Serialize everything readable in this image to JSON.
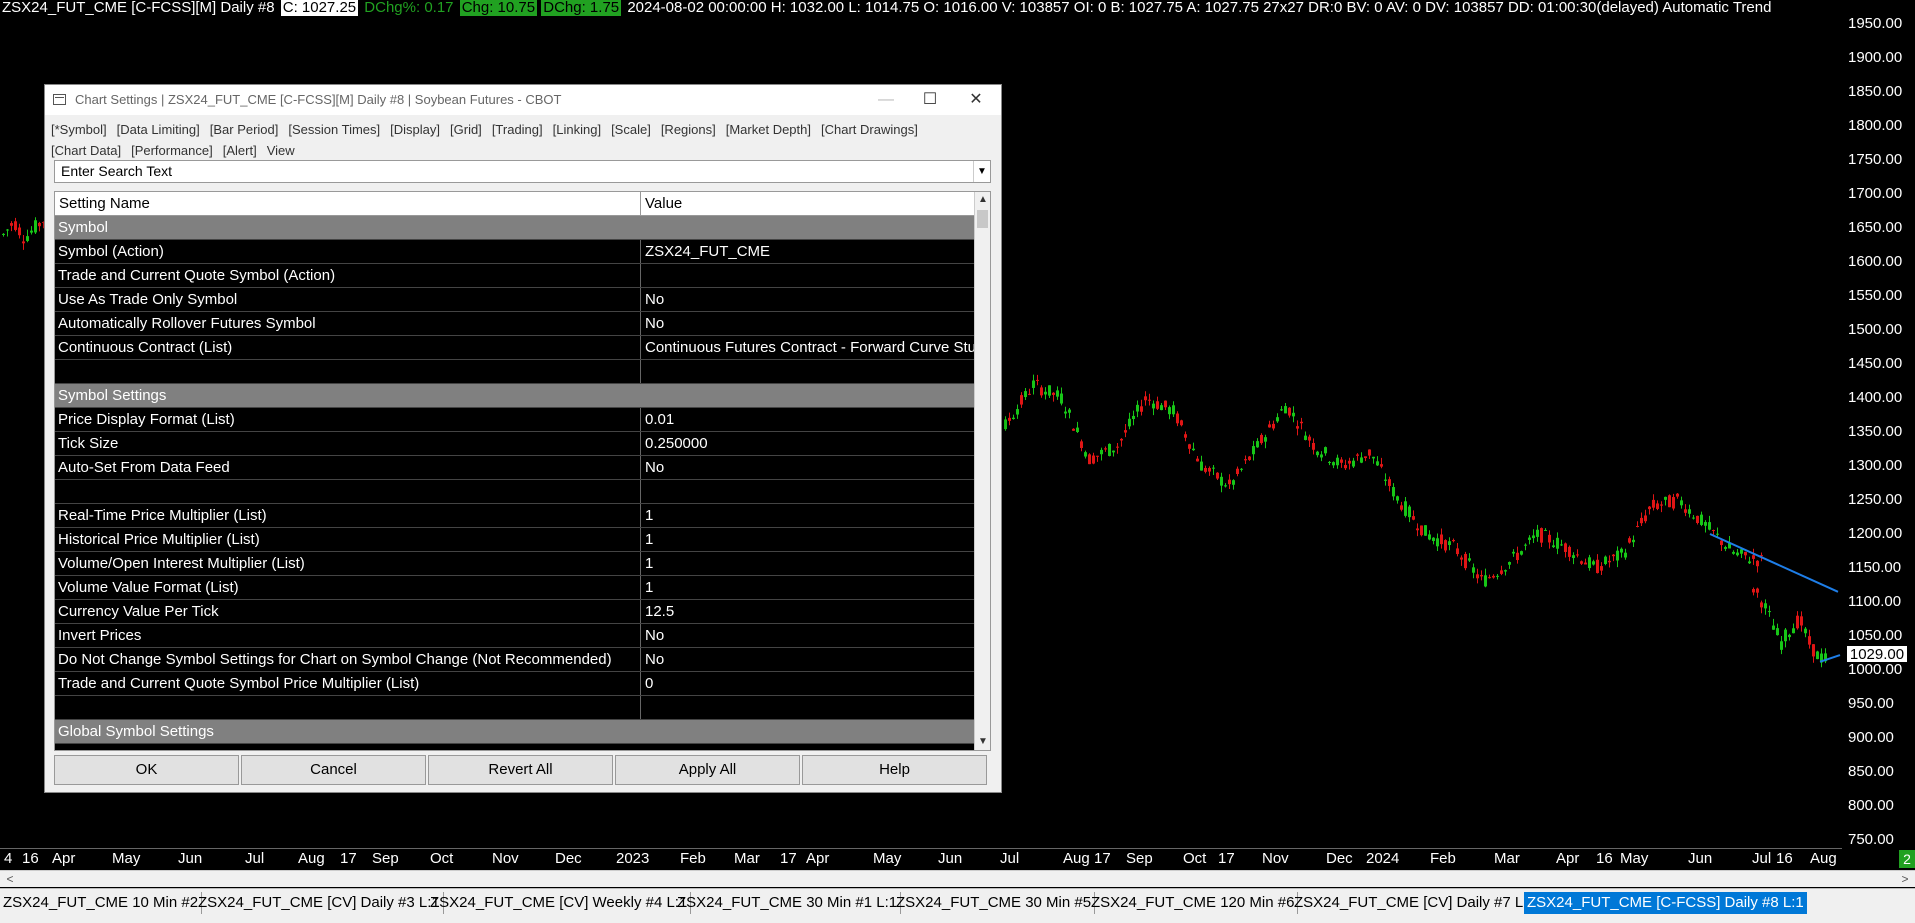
{
  "topbar": {
    "symbol": "ZSX24_FUT_CME [C-FCSS][M]  Daily #8",
    "close": "C: 1027.25",
    "dchg_pct": "DChg%: 0.17",
    "chg": "Chg: 10.75",
    "dchg": "DChg: 1.75",
    "rest": "2024-08-02 00:00:00 H: 1032.00 L: 1014.75 O: 1016.00 V: 103857 OI: 0 B: 1027.75 A: 1027.75 27x27 DR:0 BV: 0 AV: 0 DV: 103857 DD: 01:00:30(delayed) Automatic Trend"
  },
  "yaxis": {
    "ticks": [
      "1950.00",
      "1900.00",
      "1850.00",
      "1800.00",
      "1750.00",
      "1700.00",
      "1650.00",
      "1600.00",
      "1550.00",
      "1500.00",
      "1450.00",
      "1400.00",
      "1350.00",
      "1300.00",
      "1250.00",
      "1200.00",
      "1150.00",
      "1100.00",
      "1050.00",
      "1000.00",
      "950.00",
      "900.00",
      "850.00",
      "800.00",
      "750.00"
    ],
    "current_price": "1029.00"
  },
  "xaxis": {
    "ticks": [
      "4",
      "16",
      "Apr",
      "May",
      "Jun",
      "Jul",
      "Aug",
      "17",
      "Sep",
      "Oct",
      "Nov",
      "Dec",
      "2023",
      "Feb",
      "Mar",
      "17",
      "Apr",
      "May",
      "Jun",
      "Jul",
      "Aug",
      "17",
      "Sep",
      "Oct",
      "17",
      "Nov",
      "Dec",
      "2024",
      "Feb",
      "Mar",
      "Apr",
      "16",
      "May",
      "Jun",
      "Jul",
      "16",
      "Aug"
    ]
  },
  "colors": {
    "up": "#17c617",
    "down": "#e01515",
    "trendline": "#1e7ee8",
    "tab_active": "#0078d7",
    "badge": "#21a121"
  },
  "series": {
    "trend_closes": [
      1205,
      1195,
      1185,
      1182,
      1175,
      1168,
      1160,
      1150,
      1142,
      1135,
      1140,
      1120,
      1115,
      1110,
      1090,
      1075,
      1070,
      1062,
      1055,
      1050,
      1045,
      1040,
      1050,
      1060,
      1070,
      1065,
      1040,
      1030,
      1020,
      1015,
      1025,
      1029
    ]
  },
  "badge": "2",
  "tabs": [
    "ZSX24_FUT_CME  10 Min  #2",
    "ZSX24_FUT_CME [CV]  Daily #3 L:1",
    "ZSX24_FUT_CME [CV]  Weekly #4 L:1",
    "ZSX24_FUT_CME  30 Min  #1 L:1",
    "ZSX24_FUT_CME  30 Min  #5",
    "ZSX24_FUT_CME  120 Min  #6",
    "ZSX24_FUT_CME [CV]  Daily #7 L:1",
    "ZSX24_FUT_CME [C-FCSS]  Daily #8 L:1"
  ],
  "dialog": {
    "title": "Chart Settings | ZSX24_FUT_CME [C-FCSS][M]  Daily #8 | Soybean Futures - CBOT",
    "menu": [
      "[*Symbol]",
      "[Data Limiting]",
      "[Bar Period]",
      "[Session Times]",
      "[Display]",
      "[Grid]",
      "[Trading]",
      "[Linking]",
      "[Scale]",
      "[Regions]",
      "[Market Depth]",
      "[Chart Drawings]",
      "[Chart Data]",
      "[Performance]",
      "[Alert]",
      "View"
    ],
    "search_text": "Enter Search Text",
    "col_name": "Setting Name",
    "col_value": "Value",
    "rows": [
      {
        "name": "Symbol",
        "value": "",
        "section": true
      },
      {
        "name": "Symbol (Action)",
        "value": "ZSX24_FUT_CME"
      },
      {
        "name": "Trade and Current Quote Symbol (Action)",
        "value": ""
      },
      {
        "name": "Use As Trade Only Symbol",
        "value": "No"
      },
      {
        "name": "Automatically Rollover Futures Symbol",
        "value": "No"
      },
      {
        "name": "Continuous Contract (List)",
        "value": "Continuous Futures Contract - Forward Curve Study"
      },
      {
        "name": "",
        "value": ""
      },
      {
        "name": "Symbol Settings",
        "value": "",
        "section": true
      },
      {
        "name": "Price Display Format (List)",
        "value": "0.01"
      },
      {
        "name": "Tick Size",
        "value": "0.250000"
      },
      {
        "name": "Auto-Set From Data Feed",
        "value": "No"
      },
      {
        "name": "",
        "value": ""
      },
      {
        "name": "Real-Time Price Multiplier (List)",
        "value": "1"
      },
      {
        "name": "Historical Price Multiplier (List)",
        "value": "1"
      },
      {
        "name": "Volume/Open Interest Multiplier (List)",
        "value": "1"
      },
      {
        "name": "Volume Value Format (List)",
        "value": "1"
      },
      {
        "name": "Currency Value Per Tick",
        "value": "12.5"
      },
      {
        "name": "Invert Prices",
        "value": "No"
      },
      {
        "name": "Do Not Change Symbol Settings for Chart on Symbol Change (Not Recommended)",
        "value": "No"
      },
      {
        "name": "Trade and Current Quote Symbol Price Multiplier (List)",
        "value": "0"
      },
      {
        "name": "",
        "value": ""
      },
      {
        "name": "Global Symbol Settings",
        "value": "",
        "section": true
      }
    ],
    "buttons": [
      "OK",
      "Cancel",
      "Revert All",
      "Apply All",
      "Help"
    ]
  }
}
